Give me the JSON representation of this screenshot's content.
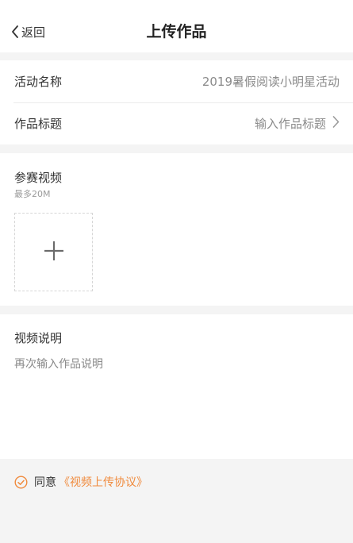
{
  "navbar": {
    "back_label": "返回",
    "title": "上传作品"
  },
  "info": {
    "activity_label": "活动名称",
    "activity_value": "2019暑假阅读小明星活动",
    "work_title_label": "作品标题",
    "work_title_placeholder": "输入作品标题"
  },
  "video": {
    "label": "参赛视频",
    "limit": "最多20M",
    "upload_icon": "plus-icon"
  },
  "description": {
    "label": "视频说明",
    "placeholder": "再次输入作品说明"
  },
  "agreement": {
    "prefix": "同意",
    "link_label": "《视频上传协议》",
    "checked": true,
    "icon": "check-circle-icon"
  },
  "colors": {
    "accent": "#f08a3c",
    "page_background": "#f4f4f4",
    "card_background": "#ffffff",
    "muted_text": "#8a8a8a"
  }
}
